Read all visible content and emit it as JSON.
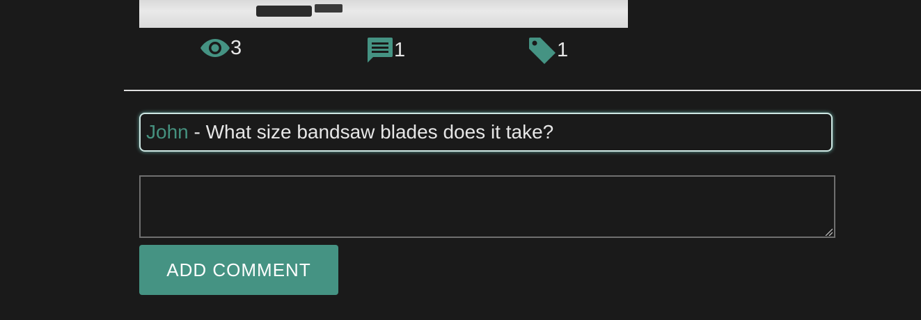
{
  "colors": {
    "accent": "#459383",
    "background": "#1a1a1a",
    "text": "#e6e6e6"
  },
  "stats": {
    "views": {
      "icon": "eye-icon",
      "count": "3"
    },
    "comments": {
      "icon": "comment-icon",
      "count": "1"
    },
    "tags": {
      "icon": "tag-icon",
      "count": "1"
    }
  },
  "comment": {
    "author": "John",
    "separator": " - ",
    "text": "What size bandsaw blades does it take?"
  },
  "new_comment": {
    "value": "",
    "placeholder": ""
  },
  "add_button": {
    "label": "ADD COMMENT"
  }
}
